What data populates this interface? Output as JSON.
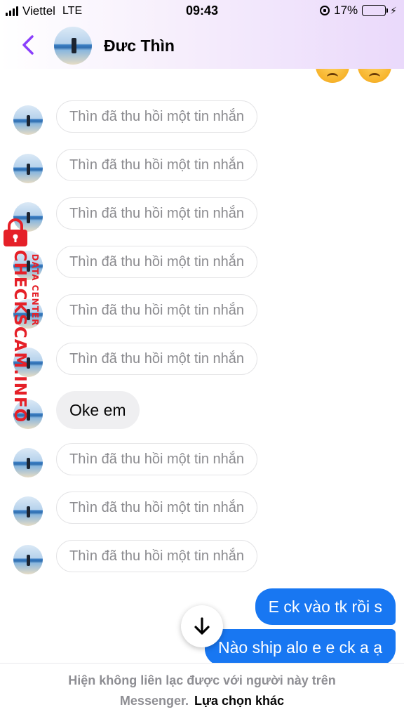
{
  "status_bar": {
    "carrier": "Viettel",
    "network": "LTE",
    "time": "09:43",
    "battery_percent": "17%",
    "battery_level": 0.17,
    "icons": [
      "signal-icon",
      "orientation-lock-icon",
      "battery-icon",
      "charging-icon"
    ]
  },
  "header": {
    "contact_name": "Đưc Thìn",
    "icons": [
      "back-chevron-icon"
    ]
  },
  "messages": [
    {
      "type": "recalled",
      "text": "Thìn đã thu hồi một tin nhắn"
    },
    {
      "type": "recalled",
      "text": "Thìn đã thu hồi một tin nhắn"
    },
    {
      "type": "recalled",
      "text": "Thìn đã thu hồi một tin nhắn"
    },
    {
      "type": "recalled",
      "text": "Thìn đã thu hồi một tin nhắn"
    },
    {
      "type": "recalled",
      "text": "Thìn đã thu hồi một tin nhắn"
    },
    {
      "type": "recalled",
      "text": "Thìn đã thu hồi một tin nhắn"
    },
    {
      "type": "incoming",
      "text": "Oke em"
    },
    {
      "type": "recalled",
      "text": "Thìn đã thu hồi một tin nhắn"
    },
    {
      "type": "recalled",
      "text": "Thìn đã thu hồi một tin nhắn"
    },
    {
      "type": "recalled",
      "text": "Thìn đã thu hồi một tin nhắn"
    },
    {
      "type": "outgoing",
      "text": "E ck vào tk rồi s"
    },
    {
      "type": "outgoing",
      "text": "Nào ship alo e e ck a ạ"
    }
  ],
  "footer": {
    "line1": "Hiện không liên lạc được với người này trên",
    "line2_muted": "Messenger.",
    "line2_link": "Lựa chọn khác"
  },
  "watermark": {
    "main": "CHECKSCAM.INFO",
    "sub": "DATA CENTER"
  },
  "colors": {
    "accent": "#8a3ffc",
    "outgoing_bubble": "#1877f2",
    "watermark": "#e52028"
  }
}
